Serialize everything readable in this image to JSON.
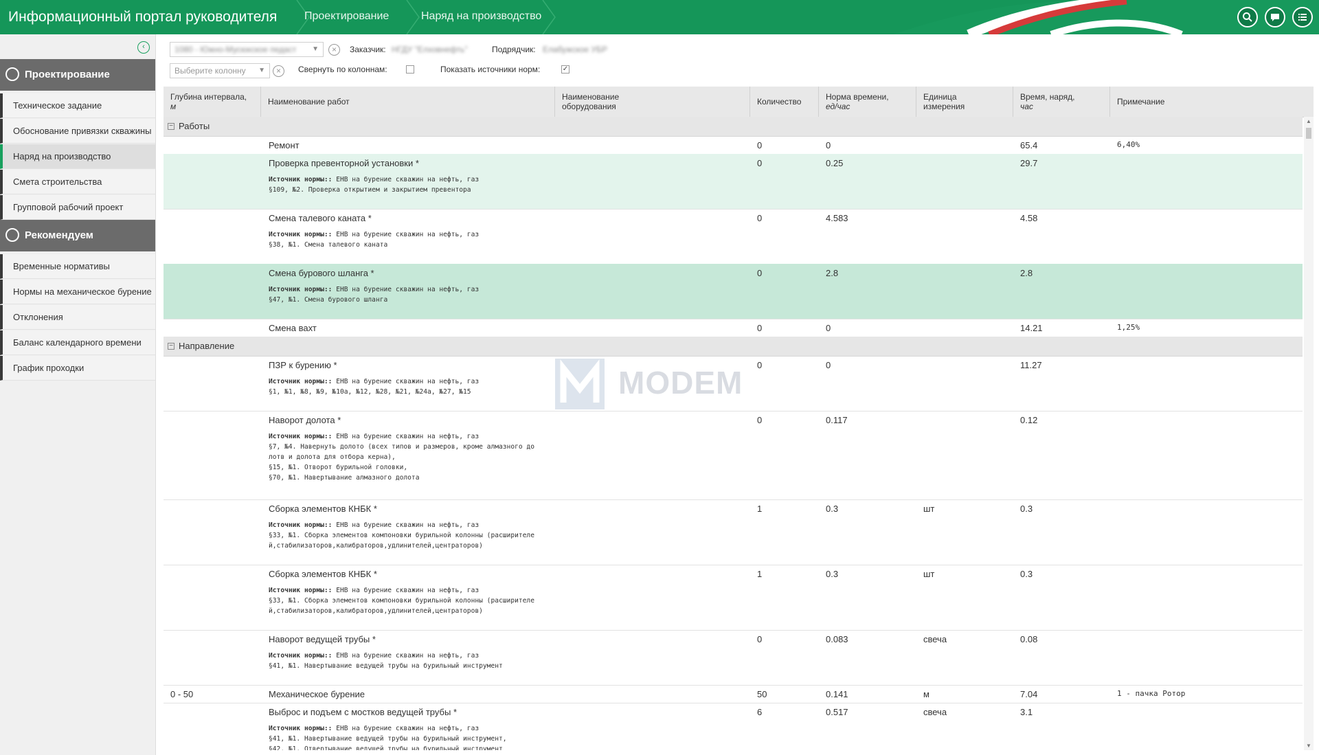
{
  "header": {
    "title": "Информационный портал руководителя",
    "breadcrumbs": [
      "Проектирование",
      "Наряд на производство"
    ],
    "icons": [
      "search-icon",
      "chat-icon",
      "list-icon"
    ],
    "accent": "#159659"
  },
  "sidebar": {
    "sections": [
      {
        "title": "Проектирование",
        "icon": "layers-icon",
        "items": [
          {
            "label": "Техническое задание"
          },
          {
            "label": "Обоснование привязки скважины"
          },
          {
            "label": "Наряд на производство",
            "active": true
          },
          {
            "label": "Смета строительства"
          },
          {
            "label": "Групповой рабочий проект"
          }
        ]
      },
      {
        "title": "Рекомендуем",
        "icon": "share-icon",
        "items": [
          {
            "label": "Временные нормативы"
          },
          {
            "label": "Нормы на механическое бурение"
          },
          {
            "label": "Отклонения"
          },
          {
            "label": "Баланс календарного времени"
          },
          {
            "label": "График проходки"
          }
        ]
      }
    ]
  },
  "filters": {
    "well_select_value": "1080 - Южно-Мусюкское педаст",
    "customer_label": "Заказчик:",
    "customer_value": "НГДУ \"Елховнефть\"",
    "contractor_label": "Подрядчик:",
    "contractor_value": "Елабужское УБР",
    "column_placeholder": "Выберите колонну",
    "collapse_label": "Свернуть по колоннам:",
    "collapse_checked": false,
    "show_sources_label": "Показать источники норм:",
    "show_sources_checked": true
  },
  "table": {
    "columns": [
      {
        "title": "Глубина интервала,",
        "unit": "м"
      },
      {
        "title": "Наименование работ",
        "unit": ""
      },
      {
        "title": "Наименование оборудования",
        "unit": ""
      },
      {
        "title": "Количество",
        "unit": ""
      },
      {
        "title": "Норма времени,",
        "unit": "ед/час"
      },
      {
        "title": "Единица измерения",
        "unit": ""
      },
      {
        "title": "Время, наряд,",
        "unit": "час"
      },
      {
        "title": "Примечание",
        "unit": ""
      }
    ],
    "source_label": "Источник нормы::",
    "groups": [
      {
        "title": "Работы",
        "rows": [
          {
            "depth": "",
            "name": "Ремонт",
            "equip": "",
            "qty": "0",
            "norm": "0",
            "unit": "",
            "time": "65.4",
            "note": "6,40%",
            "src": []
          },
          {
            "depth": "",
            "name": "Проверка превенторной установки *",
            "equip": "",
            "qty": "0",
            "norm": "0.25",
            "unit": "",
            "time": "29.7",
            "note": "",
            "highlight": "light",
            "src": [
              "ЕНВ на бурение скважин на нефть, газ",
              "§109, №2. Проверка открытием и закрытием превентора"
            ]
          },
          {
            "depth": "",
            "name": "Смена талевого каната *",
            "equip": "",
            "qty": "0",
            "norm": "4.583",
            "unit": "",
            "time": "4.58",
            "note": "",
            "src": [
              "ЕНВ на бурение скважин на нефть, газ",
              "§38, №1. Смена талевого каната"
            ]
          },
          {
            "depth": "",
            "name": "Смена бурового шланга *",
            "equip": "",
            "qty": "0",
            "norm": "2.8",
            "unit": "",
            "time": "2.8",
            "note": "",
            "highlight": "strong",
            "src": [
              "ЕНВ на бурение скважин на нефть, газ",
              "§47, №1. Смена бурового шланга"
            ]
          },
          {
            "depth": "",
            "name": "Смена вахт",
            "equip": "",
            "qty": "0",
            "norm": "0",
            "unit": "",
            "time": "14.21",
            "note": "1,25%",
            "src": []
          }
        ]
      },
      {
        "title": "Направление",
        "rows": [
          {
            "depth": "",
            "name": "ПЗР к бурению *",
            "equip": "",
            "qty": "0",
            "norm": "0",
            "unit": "",
            "time": "11.27",
            "note": "",
            "src": [
              "ЕНВ на бурение скважин на нефть, газ",
              "§1, №1, №8, №9, №10а, №12, №28, №21, №24а, №27, №15"
            ]
          },
          {
            "depth": "",
            "name": "Наворот долота *",
            "equip": "",
            "qty": "0",
            "norm": "0.117",
            "unit": "",
            "time": "0.12",
            "note": "",
            "src": [
              "ЕНВ на бурение скважин на нефть, газ",
              "§7, №4. Навернуть долото (всех типов и размеров, кроме алмазного до",
              "лотв и долота для отбора керна),",
              "§15, №1. Отворот бурильной головки,",
              "§70, №1. Навертывание алмазного долота"
            ]
          },
          {
            "depth": "",
            "name": "Сборка элементов КНБК *",
            "equip": "",
            "qty": "1",
            "norm": "0.3",
            "unit": "шт",
            "time": "0.3",
            "note": "",
            "src": [
              "ЕНВ на бурение скважин на нефть, газ",
              "§33, №1. Сборка элементов компоновки бурильной колонны (расширителе",
              "й,стабилизаторов,калибраторов,удлинителей,центраторов)"
            ]
          },
          {
            "depth": "",
            "name": "Сборка элементов КНБК *",
            "equip": "",
            "qty": "1",
            "norm": "0.3",
            "unit": "шт",
            "time": "0.3",
            "note": "",
            "src": [
              "ЕНВ на бурение скважин на нефть, газ",
              "§33, №1. Сборка элементов компоновки бурильной колонны (расширителе",
              "й,стабилизаторов,калибраторов,удлинителей,центраторов)"
            ]
          },
          {
            "depth": "",
            "name": "Наворот ведущей трубы *",
            "equip": "",
            "qty": "0",
            "norm": "0.083",
            "unit": "свеча",
            "time": "0.08",
            "note": "",
            "src": [
              "ЕНВ на бурение скважин на нефть, газ",
              "§41, №1. Навертывание ведущей трубы на бурильный инструмент"
            ]
          },
          {
            "depth": "0 - 50",
            "name": "Механическое бурение",
            "equip": "",
            "qty": "50",
            "norm": "0.141",
            "unit": "м",
            "time": "7.04",
            "note": "1 - пачка Ротор",
            "src": []
          },
          {
            "depth": "",
            "name": "Выброс и подъем с мостков ведущей трубы *",
            "equip": "",
            "qty": "6",
            "norm": "0.517",
            "unit": "свеча",
            "time": "3.1",
            "note": "",
            "src": [
              "ЕНВ на бурение скважин на нефть, газ",
              "§41, №1. Навертывание ведущей трубы на бурильный инструмент,",
              "§42, №1. Отвертывание ведущей трубы на бурильный инструмент"
            ]
          }
        ]
      }
    ]
  },
  "watermark": {
    "text": "MODEM"
  }
}
